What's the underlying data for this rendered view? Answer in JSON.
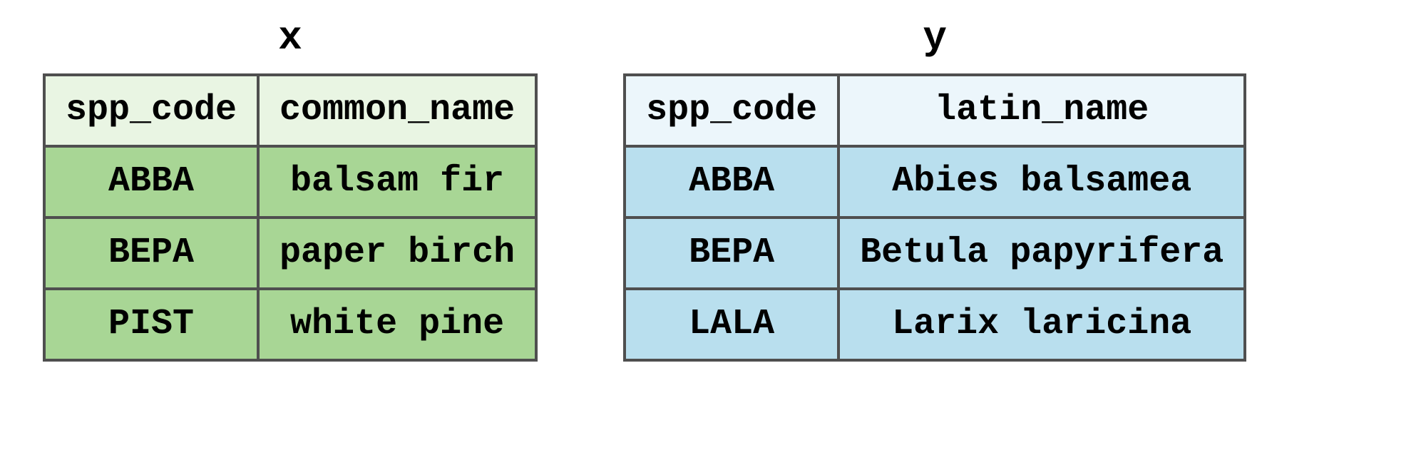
{
  "tables": {
    "x": {
      "title": "x",
      "headers": [
        "spp_code",
        "common_name"
      ],
      "rows": [
        [
          "ABBA",
          "balsam fir"
        ],
        [
          "BEPA",
          "paper birch"
        ],
        [
          "PIST",
          "white pine"
        ]
      ]
    },
    "y": {
      "title": "y",
      "headers": [
        "spp_code",
        "latin_name"
      ],
      "rows": [
        [
          "ABBA",
          "Abies balsamea"
        ],
        [
          "BEPA",
          "Betula papyrifera"
        ],
        [
          "LALA",
          "Larix laricina"
        ]
      ]
    }
  },
  "colors": {
    "x_header": "#e9f5e3",
    "x_cell": "#a8d695",
    "y_header": "#ecf6fb",
    "y_cell": "#b9dfee",
    "border": "#4f4f4f"
  }
}
